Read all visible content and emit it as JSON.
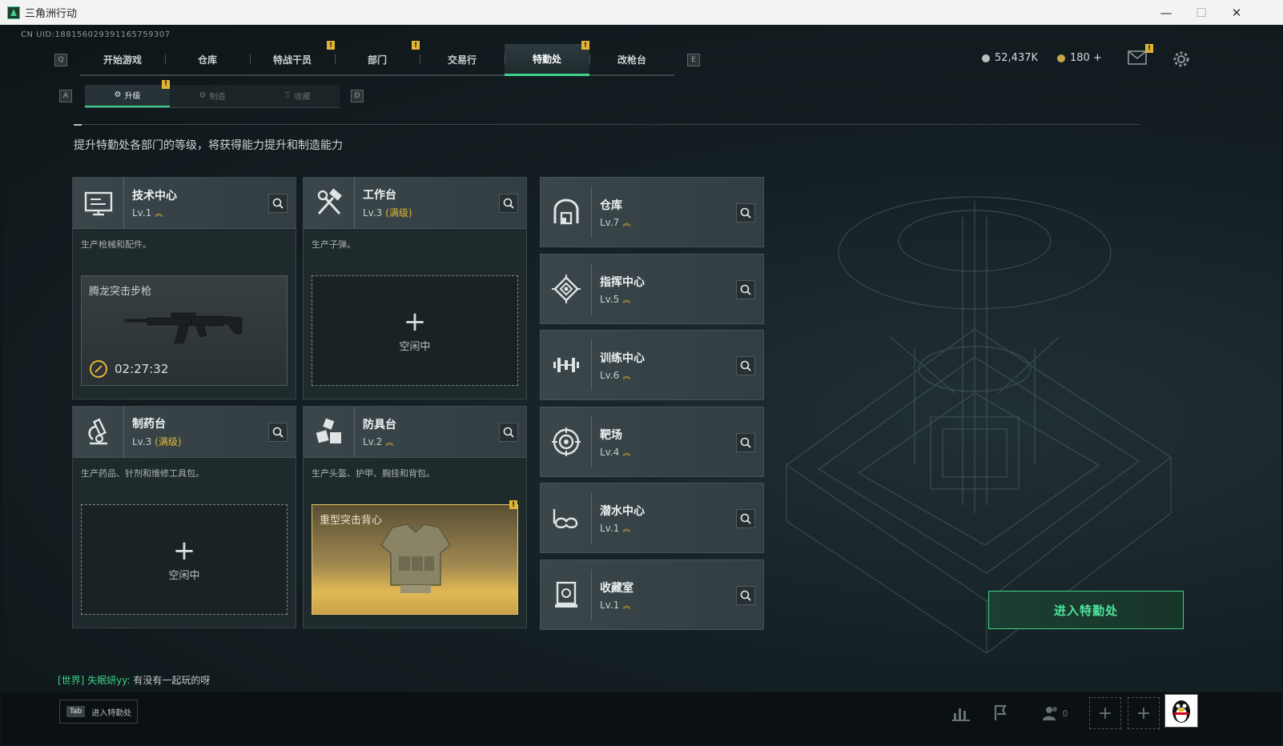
{
  "window": {
    "title": "三角洲行动",
    "minimize": "—",
    "maximize": "☐",
    "close": "✕"
  },
  "uid": "CN UID:188156029391165759307",
  "nav": {
    "left_key": "Q",
    "right_key": "E",
    "tabs": [
      {
        "label": "开始游戏",
        "badge": ""
      },
      {
        "label": "仓库",
        "badge": ""
      },
      {
        "label": "特战干员",
        "badge": "!"
      },
      {
        "label": "部门",
        "badge": "!"
      },
      {
        "label": "交易行",
        "badge": ""
      },
      {
        "label": "特勤处",
        "badge": "!",
        "active": true
      },
      {
        "label": "改枪台",
        "badge": ""
      }
    ]
  },
  "currency": {
    "coins": "52,437K",
    "tokens": "180 +",
    "mail_badge": "!"
  },
  "subnav": {
    "left_key": "A",
    "right_key": "D",
    "tabs": [
      {
        "label": "升级",
        "active": true,
        "badge": "!"
      },
      {
        "label": "制造",
        "active": false
      },
      {
        "label": "收藏",
        "active": false
      }
    ]
  },
  "description": "提升特勤处各部门的等级，将获得能力提升和制造能力",
  "workshops": [
    {
      "name": "技术中心",
      "level": "Lv.1",
      "maxed": "",
      "desc": "生产枪械和配件。",
      "icon": "monitor-icon",
      "slot": {
        "state": "busy",
        "item": "腾龙突击步枪",
        "timer": "02:27:32"
      }
    },
    {
      "name": "工作台",
      "level": "Lv.3",
      "maxed": "(满级)",
      "desc": "生产子弹。",
      "icon": "tools-icon",
      "slot": {
        "state": "idle",
        "label": "空闲中"
      }
    },
    {
      "name": "制药台",
      "level": "Lv.3",
      "maxed": "(满级)",
      "desc": "生产药品、针剂和维修工具包。",
      "icon": "microscope-icon",
      "slot": {
        "state": "idle",
        "label": "空闲中"
      }
    },
    {
      "name": "防具台",
      "level": "Lv.2",
      "maxed": "",
      "desc": "生产头盔、护甲、胸挂和背包。",
      "icon": "boxes-icon",
      "slot": {
        "state": "done",
        "item": "重型突击背心",
        "badge": "!"
      }
    }
  ],
  "facilities": [
    {
      "name": "仓库",
      "level": "Lv.7",
      "icon": "warehouse-icon"
    },
    {
      "name": "指挥中心",
      "level": "Lv.5",
      "icon": "command-icon"
    },
    {
      "name": "训练中心",
      "level": "Lv.6",
      "icon": "dumbbell-icon"
    },
    {
      "name": "靶场",
      "level": "Lv.4",
      "icon": "target-icon"
    },
    {
      "name": "潜水中心",
      "level": "Lv.1",
      "icon": "goggles-icon"
    },
    {
      "name": "收藏室",
      "level": "Lv.1",
      "icon": "collection-icon"
    }
  ],
  "enter_button": "进入特勤处",
  "chat": {
    "channel": "[世界]",
    "user": "失眠妍yy:",
    "message": "有没有一起玩的呀"
  },
  "bottom": {
    "tab_key": "Tab",
    "tab_label": "进入特勤处",
    "friends_count": "0"
  },
  "colors": {
    "accent": "#3fd18a",
    "warning": "#e3b536",
    "panel": "#3a4649",
    "background": "#101619"
  }
}
